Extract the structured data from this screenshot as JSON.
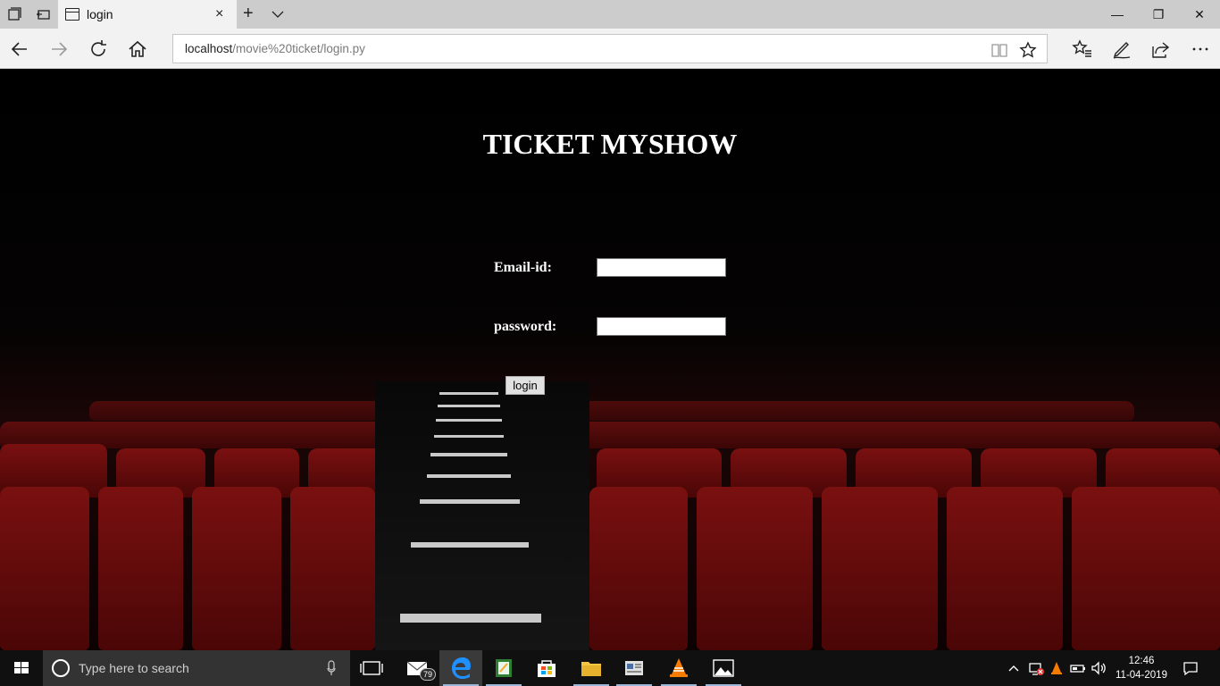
{
  "browser": {
    "tab_title": "login",
    "tab_close": "×",
    "new_tab": "+",
    "address_host": "localhost",
    "address_path": "/movie%20ticket/login.py",
    "window_controls": {
      "minimize": "—",
      "restore": "❐",
      "close": "✕"
    },
    "icons": [
      "set-tabs-aside-icon",
      "tab-preview-icon",
      "page-icon",
      "tab-list-chevron-icon",
      "back-icon",
      "forward-icon",
      "refresh-icon",
      "home-icon",
      "reading-view-icon",
      "favorite-star-icon",
      "favorites-hub-icon",
      "web-note-icon",
      "share-icon",
      "more-icon"
    ]
  },
  "page": {
    "heading": "TICKET MYSHOW",
    "email_label": "Email-id:",
    "email_value": "",
    "password_label": "password:",
    "password_value": "",
    "login_button": "login"
  },
  "taskbar": {
    "search_placeholder": "Type here to search",
    "mail_badge": "79",
    "time": "12:46",
    "date": "11-04-2019",
    "accent": "#9ab7d9",
    "apps": [
      "task-view-icon",
      "mail-icon",
      "edge-icon",
      "app-icon",
      "store-icon",
      "file-explorer-icon",
      "document-icon",
      "vlc-icon",
      "photos-icon"
    ]
  },
  "colors": {
    "seat_red": "#7a1010",
    "titlebar": "#cccccc",
    "navbar": "#f2f2f2",
    "taskbar": "#101010"
  }
}
